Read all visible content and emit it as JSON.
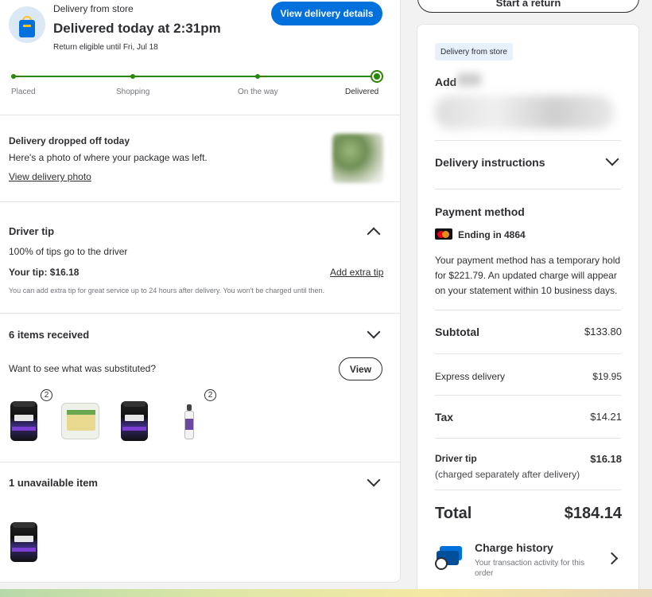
{
  "order": {
    "delivery_type": "Delivery from store",
    "status_title": "Delivered today at 2:31pm",
    "return_eligibility": "Return eligible until Fri, Jul 18",
    "view_details_label": "View delivery details"
  },
  "progress": {
    "steps": [
      "Placed",
      "Shopping",
      "On the way",
      "Delivered"
    ],
    "current_step": "Delivered"
  },
  "dropoff": {
    "title": "Delivery dropped off today",
    "description": "Here's a photo of where your package was left.",
    "link_label": "View delivery photo"
  },
  "driver_tip": {
    "title": "Driver tip",
    "note": "100% of tips go to the driver",
    "tip_label": "Your tip: $16.18",
    "add_tip_label": "Add extra tip",
    "disclaimer": "You can add extra tip for great service up to 24 hours after delivery. You won't be charged until then."
  },
  "items_received": {
    "title": "6 items received",
    "substitution_prompt": "Want to see what was substituted?",
    "view_label": "View",
    "items": [
      {
        "name": "protein-jar",
        "qty": "2"
      },
      {
        "name": "cheese-pack",
        "qty": ""
      },
      {
        "name": "protein-jar",
        "qty": ""
      },
      {
        "name": "spray-bottle",
        "qty": "2"
      }
    ]
  },
  "unavailable": {
    "title": "1 unavailable item"
  },
  "right_panel": {
    "start_return_label": "Start a return",
    "delivery_pill": "Delivery from store",
    "address_label": "Add",
    "delivery_instructions": "Delivery instructions",
    "payment_method_title": "Payment method",
    "card_label": "Ending in 4864",
    "hold_notice": "Your payment method has a temporary hold for $221.79. An updated charge will appear on your statement within 10 business days.",
    "subtotal_label": "Subtotal",
    "subtotal_value": "$133.80",
    "express_label": "Express delivery",
    "express_value": "$19.95",
    "tax_label": "Tax",
    "tax_value": "$14.21",
    "tip_label": "Driver tip",
    "tip_value": "$16.18",
    "tip_note": "(charged separately after delivery)",
    "total_label": "Total",
    "total_value": "$184.14",
    "charge_history_title": "Charge history",
    "charge_history_desc": "Your transaction activity for this order"
  },
  "colors": {
    "accent": "#0071dc",
    "success": "#2a8703",
    "text": "#2e2f32"
  }
}
